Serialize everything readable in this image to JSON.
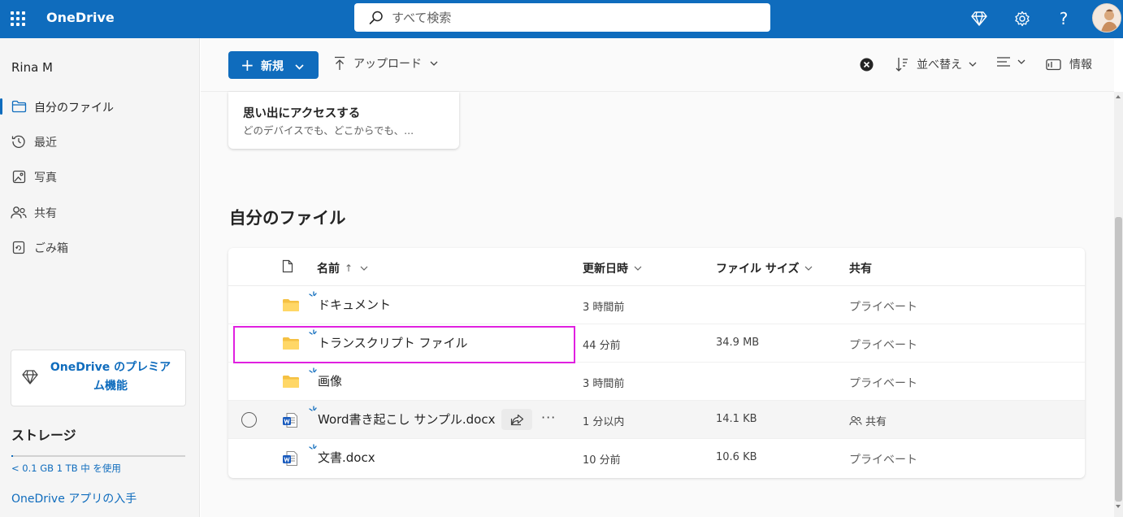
{
  "app": {
    "title": "OneDrive",
    "search_placeholder": "すべて検索"
  },
  "sidebar": {
    "user": "Rina M",
    "items": [
      {
        "label": "自分のファイル",
        "icon": "folder-icon",
        "active": true
      },
      {
        "label": "最近",
        "icon": "history-icon",
        "active": false
      },
      {
        "label": "写真",
        "icon": "photo-icon",
        "active": false
      },
      {
        "label": "共有",
        "icon": "people-icon",
        "active": false
      },
      {
        "label": "ごみ箱",
        "icon": "recycle-bin-icon",
        "active": false
      }
    ],
    "premium": "OneDrive のプレミアム機能",
    "storage_title": "ストレージ",
    "storage_text": "< 0.1 GB 1 TB 中 を使用",
    "storage_used_fraction": 0.01,
    "get_app": "OneDrive アプリの入手"
  },
  "commandbar": {
    "new_label": "新規",
    "upload_label": "アップロード",
    "sort_label": "並べ替え",
    "info_label": "情報"
  },
  "card": {
    "title": "思い出にアクセスする",
    "subtitle": "どのデバイスでも、どこからでも、..."
  },
  "section_title": "自分のファイル",
  "table": {
    "headers": {
      "name": "名前",
      "name_sort": "↑",
      "modified": "更新日時",
      "size": "ファイル サイズ",
      "sharing": "共有"
    },
    "rows": [
      {
        "name": "ドキュメント",
        "type": "folder",
        "modified": "3 時間前",
        "size": "",
        "sharing": "プライベート"
      },
      {
        "name": "トランスクリプト ファイル",
        "type": "folder",
        "modified": "44 分前",
        "size": "34.9 MB",
        "sharing": "プライベート"
      },
      {
        "name": "画像",
        "type": "folder",
        "modified": "3 時間前",
        "size": "",
        "sharing": "プライベート"
      },
      {
        "name": "Word書き起こし サンプル.docx",
        "type": "word",
        "modified": "1 分以内",
        "size": "14.1 KB",
        "sharing": "共有"
      },
      {
        "name": "文書.docx",
        "type": "word",
        "modified": "10 分前",
        "size": "10.6 KB",
        "sharing": "プライベート"
      }
    ]
  },
  "colors": {
    "accent": "#0f6cbd",
    "highlight": "#e020e0",
    "folder": "#f5c143"
  }
}
